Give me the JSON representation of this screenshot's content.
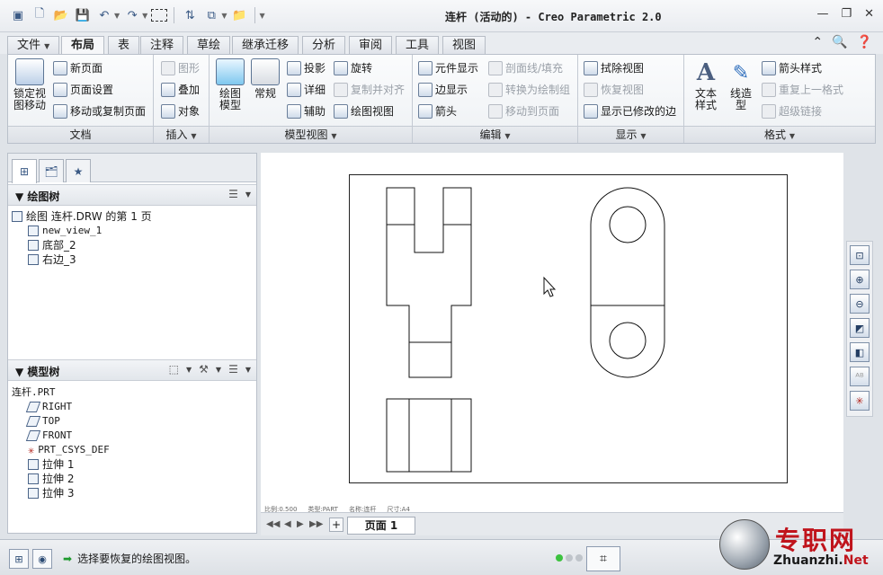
{
  "window": {
    "title": "连杆 (活动的) - Creo Parametric 2.0"
  },
  "quick_access": {
    "icons": [
      "app-logo-icon",
      "new-icon",
      "open-icon",
      "save-icon",
      "undo-icon",
      "redo-icon",
      "select-box-icon",
      "regenerate-icon",
      "windows-icon",
      "folder-icon",
      "customize-icon"
    ]
  },
  "menu_tabs": [
    {
      "label": "文件",
      "active": false
    },
    {
      "label": "布局",
      "active": true
    },
    {
      "label": "表",
      "active": false
    },
    {
      "label": "注释",
      "active": false
    },
    {
      "label": "草绘",
      "active": false
    },
    {
      "label": "继承迁移",
      "active": false
    },
    {
      "label": "分析",
      "active": false
    },
    {
      "label": "审阅",
      "active": false
    },
    {
      "label": "工具",
      "active": false
    },
    {
      "label": "视图",
      "active": false
    }
  ],
  "ribbon": {
    "doc": {
      "label": "文档",
      "lock_view": "锁定视图移动",
      "new_page": "新页面",
      "page_setup": "页面设置",
      "move_copy_page": "移动或复制页面"
    },
    "insert": {
      "label": "插入",
      "graphics": "图形",
      "overlay": "叠加",
      "object": "对象"
    },
    "model_views": {
      "label": "模型视图",
      "drawing_model": "绘图模型",
      "general": "常规",
      "projection": "投影",
      "detailed": "详细",
      "auxiliary": "辅助",
      "revolved": "旋转",
      "copy_align": "复制并对齐",
      "drawing_view": "绘图视图"
    },
    "edit": {
      "label": "编辑",
      "element_display": "元件显示",
      "edge_display": "边显示",
      "arrow": "箭头",
      "section_fill": "剖面线/填充",
      "convert_group": "转换为绘制组",
      "move_to_page": "移动到页面"
    },
    "display": {
      "label": "显示",
      "erase_view": "拭除视图",
      "restore_view": "恢复视图",
      "show_modified_edges": "显示已修改的边"
    },
    "format": {
      "label": "格式",
      "text_style": "文本样式",
      "line_style": "线造型",
      "arrow_style": "箭头样式",
      "repeat_format": "重复上一格式",
      "hyperlink": "超级链接"
    }
  },
  "drawing_tree": {
    "title": "绘图树",
    "root": "绘图 连杆.DRW 的第 1 页",
    "items": [
      "new_view_1",
      "底部_2",
      "右边_3"
    ]
  },
  "model_tree": {
    "title": "模型树",
    "root": "连杆.PRT",
    "items": [
      "RIGHT",
      "TOP",
      "FRONT",
      "PRT_CSYS_DEF",
      "拉伸 1",
      "拉伸 2",
      "拉伸 3"
    ]
  },
  "page_nav": {
    "page_label": "页面 1",
    "add": "+",
    "info": [
      "比例:0.500",
      "类型:PART",
      "名称:连杆",
      "尺寸:A4"
    ]
  },
  "status": {
    "message": "选择要恢复的绘图视图。"
  },
  "watermark": {
    "text_cn": "专职网",
    "text_en_prefix": "Zhuanzhi.",
    "text_en_suffix": "Net"
  }
}
